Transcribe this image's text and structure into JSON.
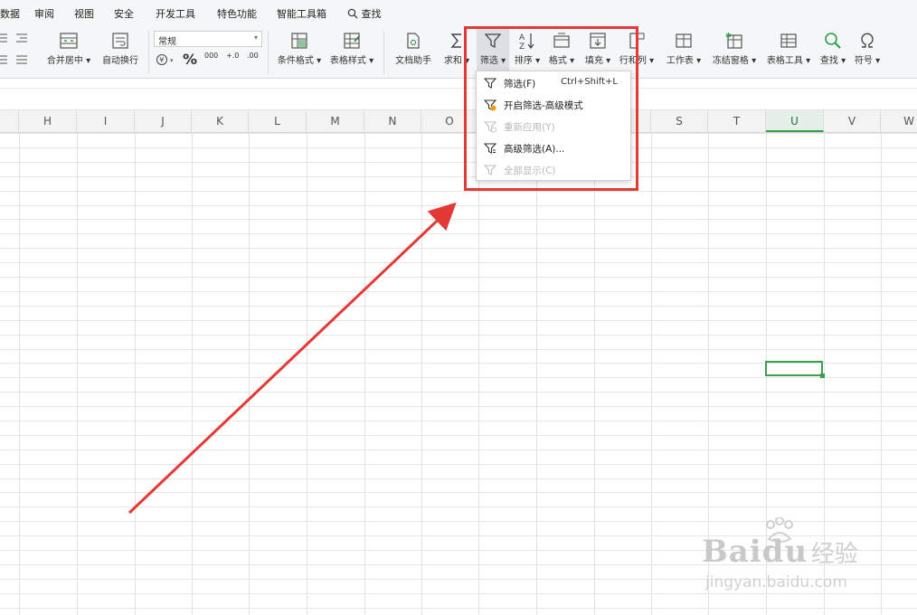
{
  "menu": {
    "tabs": [
      "数据",
      "审阅",
      "视图",
      "安全",
      "开发工具",
      "特色功能",
      "智能工具箱"
    ],
    "search_label": "查找"
  },
  "ribbon": {
    "merge_center": "合并居中",
    "wrap_text": "自动换行",
    "number_format": "常规",
    "percent": "%",
    "thousands": "000",
    "inc_decimal": "+.0",
    "dec_decimal": ".00",
    "conditional_format": "条件格式",
    "table_style": "表格样式",
    "doc_helper": "文档助手",
    "sum": "求和",
    "filter": "筛选",
    "sort": "排序",
    "format": "格式",
    "fill": "填充",
    "row_col": "行和列",
    "worksheet": "工作表",
    "freeze": "冻结窗格",
    "table_tools": "表格工具",
    "find": "查找",
    "symbol": "符号"
  },
  "columns": [
    "H",
    "I",
    "J",
    "K",
    "L",
    "M",
    "N",
    "O",
    "P",
    "Q",
    "R",
    "S",
    "T",
    "U",
    "V",
    "W"
  ],
  "active_column": "U",
  "filter_menu": {
    "items": [
      {
        "label": "筛选(F)",
        "shortcut": "Ctrl+Shift+L",
        "enabled": true
      },
      {
        "label": "开启筛选-高级模式",
        "shortcut": "",
        "enabled": true
      },
      {
        "label": "重新应用(Y)",
        "shortcut": "",
        "enabled": false
      },
      {
        "label": "高级筛选(A)...",
        "shortcut": "",
        "enabled": true
      },
      {
        "label": "全部显示(C)",
        "shortcut": "",
        "enabled": false
      }
    ]
  },
  "watermark": {
    "brand": "Baidu",
    "suffix": "经验",
    "url": "jingyan.baidu.com"
  },
  "colors": {
    "highlight": "#e53935",
    "active_cell": "#3aa14a",
    "accent_icon": "#f39c12"
  }
}
